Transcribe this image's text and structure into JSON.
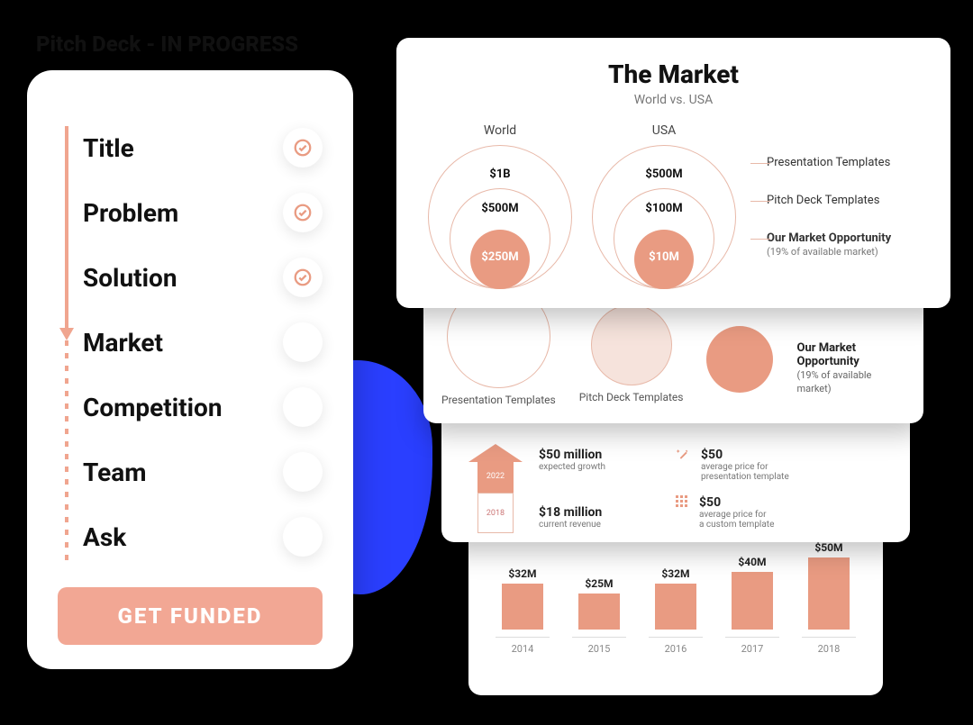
{
  "left": {
    "title": "Pitch Deck - IN PROGRESS",
    "steps": [
      {
        "label": "Title",
        "done": true
      },
      {
        "label": "Problem",
        "done": true
      },
      {
        "label": "Solution",
        "done": true
      },
      {
        "label": "Market",
        "done": false
      },
      {
        "label": "Competition",
        "done": false
      },
      {
        "label": "Team",
        "done": false
      },
      {
        "label": "Ask",
        "done": false
      }
    ],
    "cta": "GET FUNDED"
  },
  "card1": {
    "title": "The Market",
    "subtitle": "World vs. USA",
    "cols": [
      {
        "label": "World",
        "outer": "$1B",
        "mid": "$500M",
        "inner": "$250M"
      },
      {
        "label": "USA",
        "outer": "$500M",
        "mid": "$100M",
        "inner": "$10M"
      }
    ],
    "legend": [
      {
        "label": "Presentation Templates"
      },
      {
        "label": "Pitch Deck Templates"
      },
      {
        "label": "Our Market Opportunity",
        "sub": "(19% of available market)",
        "bold": true
      }
    ]
  },
  "card2": {
    "items": [
      {
        "label": "Presentation Templates"
      },
      {
        "label": "Pitch Deck Templates"
      }
    ],
    "opp": {
      "label": "Our Market Opportunity",
      "sub": "(19% of available market)"
    }
  },
  "card3": {
    "arrow": {
      "top_year": "2022",
      "bottom_year": "2018"
    },
    "growth": [
      {
        "value": "$50 million",
        "sub": "expected growth"
      },
      {
        "value": "$18 million",
        "sub": "current revenue"
      }
    ],
    "prices": [
      {
        "value": "$50",
        "sub1": "average price for",
        "sub2": "presentation template"
      },
      {
        "value": "$50",
        "sub1": "average price for",
        "sub2": "a custom template"
      }
    ]
  },
  "chart_data": {
    "type": "bar",
    "categories": [
      "2014",
      "2015",
      "2016",
      "2017",
      "2018"
    ],
    "values": [
      32,
      25,
      32,
      40,
      50
    ],
    "labels": [
      "$32M",
      "$25M",
      "$32M",
      "$40M",
      "$50M"
    ],
    "ylim": [
      0,
      50
    ],
    "title": "",
    "xlabel": "",
    "ylabel": ""
  }
}
